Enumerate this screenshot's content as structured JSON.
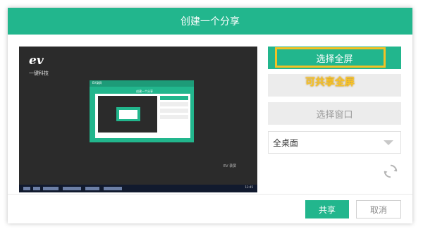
{
  "dialog": {
    "title": "创建一个分享"
  },
  "preview": {
    "logo_text": "ev",
    "logo_subtext": "一键科技",
    "inner_window_title": "EV录屏",
    "inner_dialog_title": "创建一个分享",
    "taskbar_text": "13:45",
    "watermark_text": "EV 录屏"
  },
  "buttons": {
    "fullscreen_label": "选择全屏",
    "region_label": "",
    "window_label": "选择窗口",
    "share_label": "共享",
    "cancel_label": "取消"
  },
  "annotation": {
    "text": "可共享全屏"
  },
  "screen_select": {
    "selected": "全桌面"
  },
  "icons": {
    "dropdown": "chevron-down-icon",
    "refresh": "refresh-icon"
  },
  "colors": {
    "accent": "#22b68d",
    "highlight": "#f3c125",
    "disabled_bg": "#ececec"
  }
}
